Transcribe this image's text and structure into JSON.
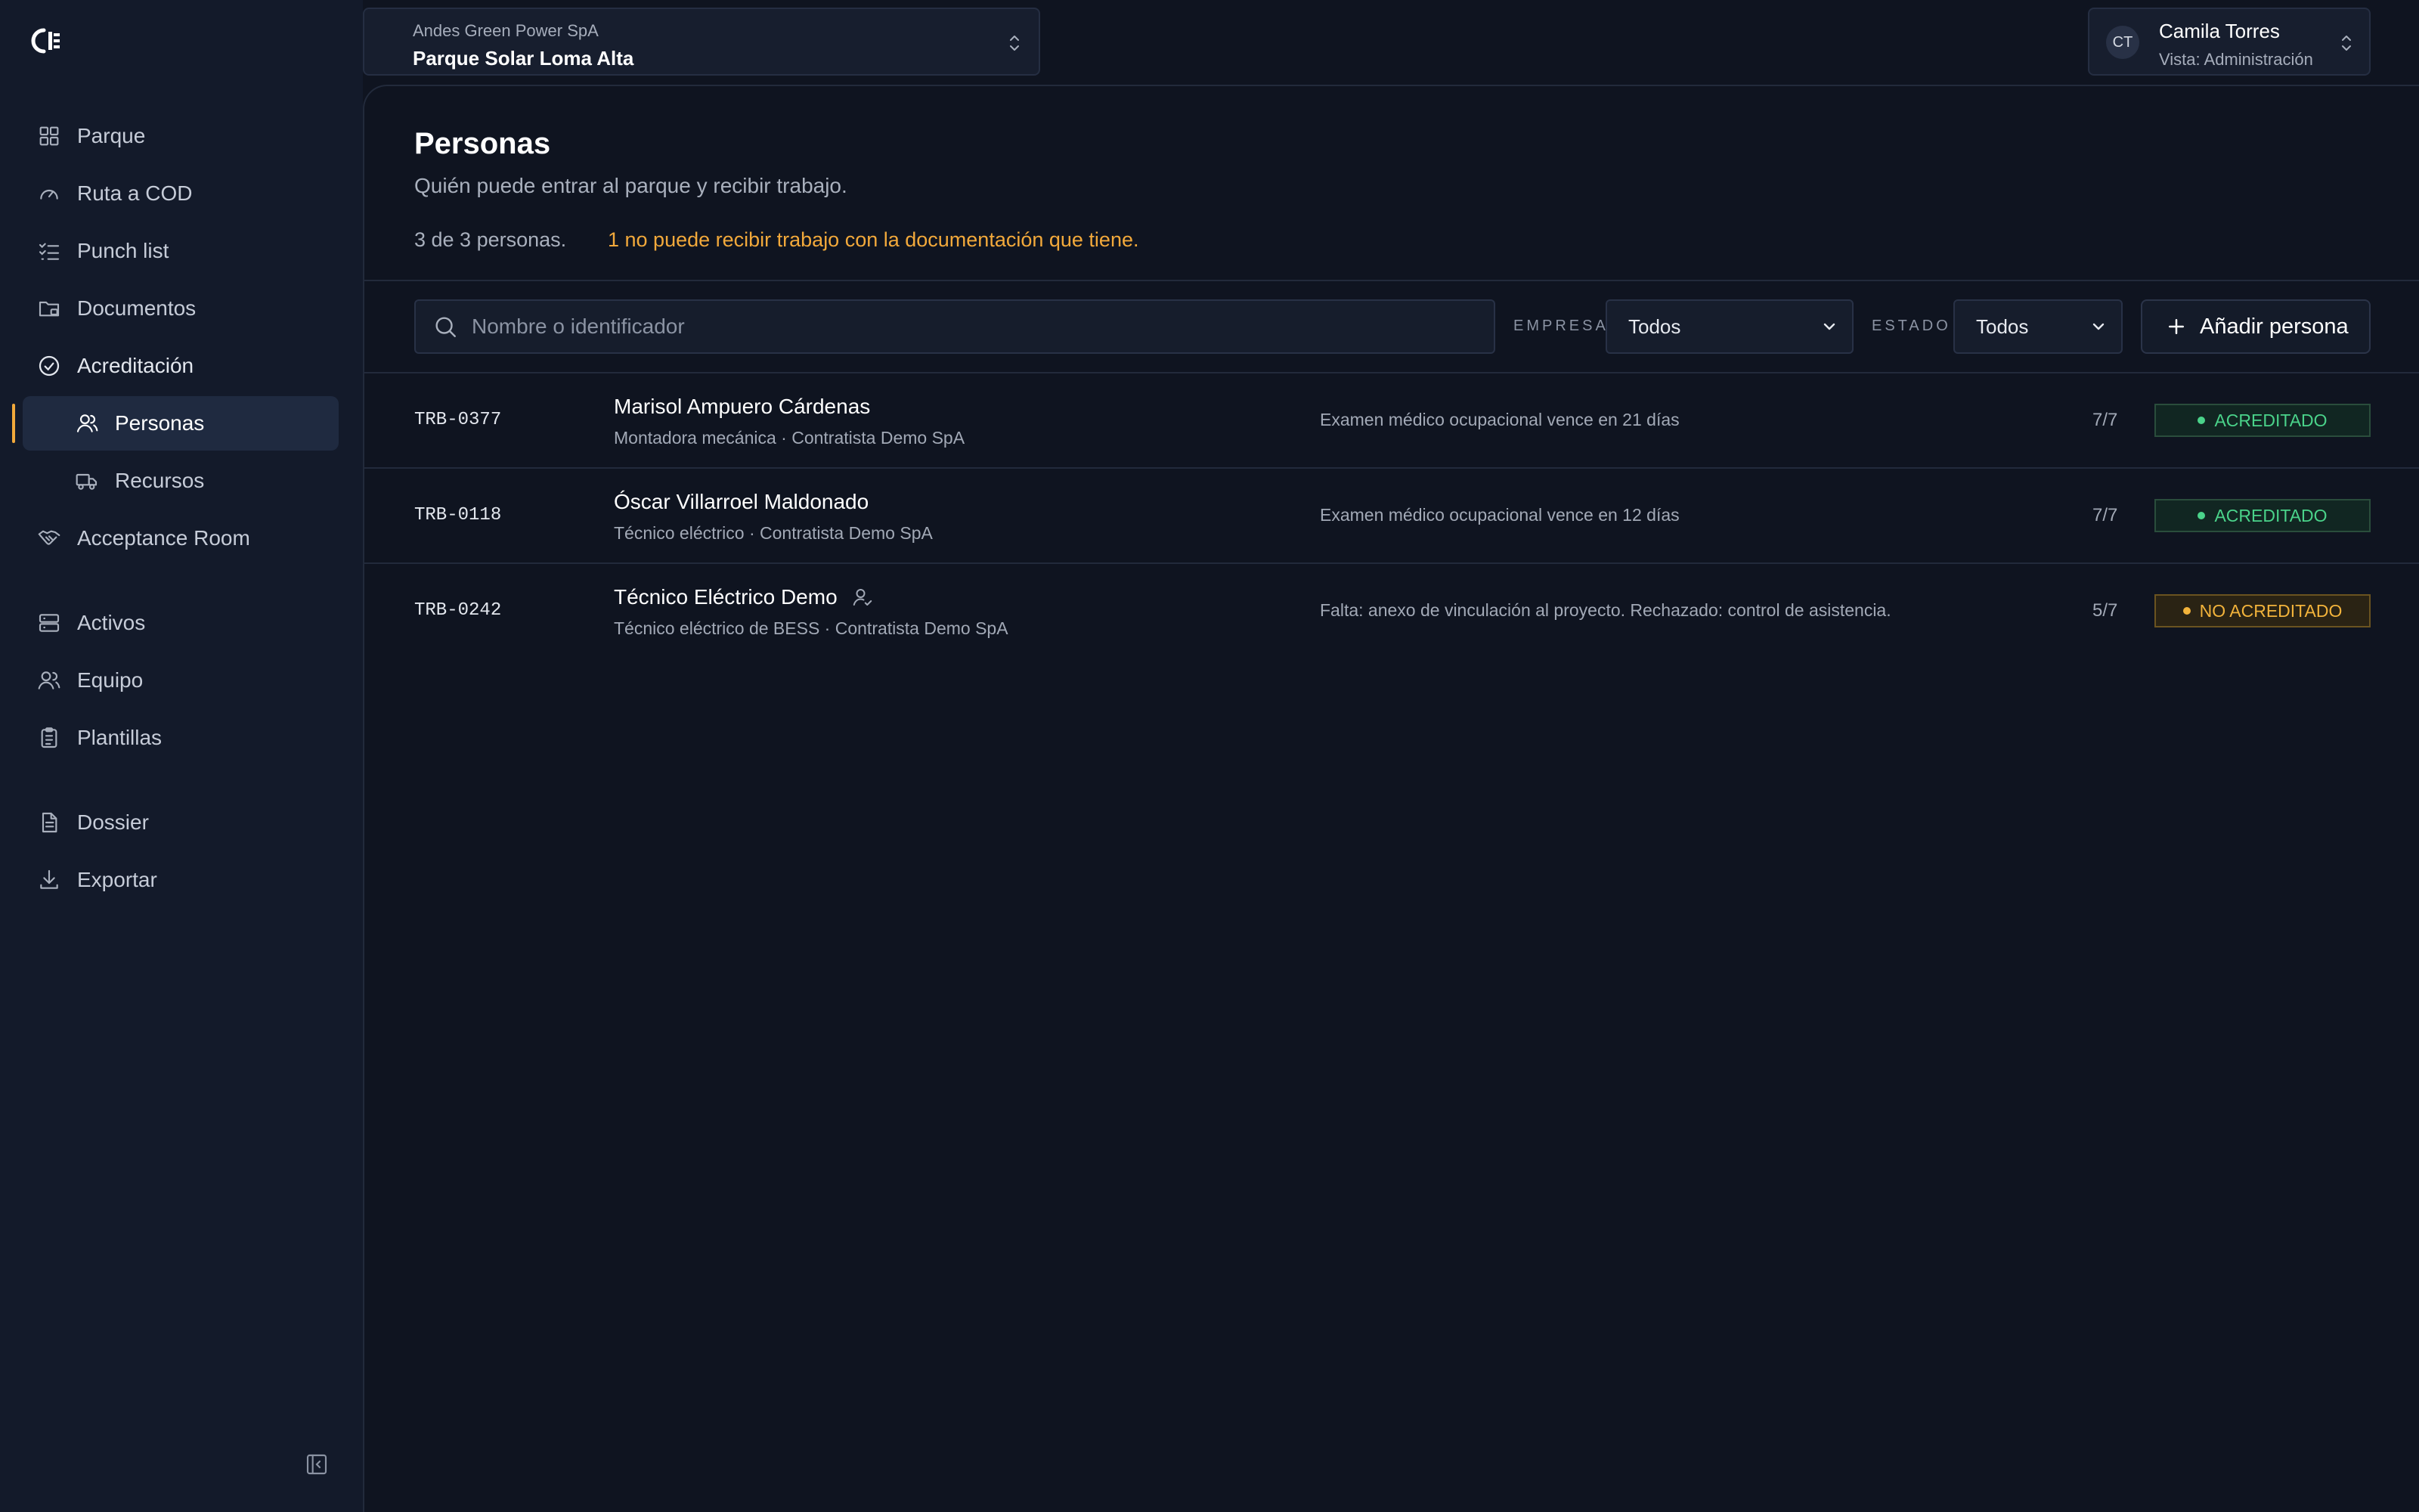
{
  "header": {
    "org_name": "Andes Green Power SpA",
    "project_name": "Parque Solar Loma Alta",
    "user_initials": "CT",
    "user_name": "Camila Torres",
    "user_role": "Vista: Administración"
  },
  "sidebar": {
    "items": [
      {
        "label": "Parque",
        "icon": "grid-icon"
      },
      {
        "label": "Ruta a COD",
        "icon": "gauge-icon"
      },
      {
        "label": "Punch list",
        "icon": "checklist-icon"
      },
      {
        "label": "Documentos",
        "icon": "folder-icon"
      },
      {
        "label": "Acreditación",
        "icon": "check-circle-icon"
      },
      {
        "label": "Personas",
        "icon": "users-icon"
      },
      {
        "label": "Recursos",
        "icon": "truck-icon"
      },
      {
        "label": "Acceptance Room",
        "icon": "handshake-icon"
      },
      {
        "label": "Activos",
        "icon": "server-icon"
      },
      {
        "label": "Equipo",
        "icon": "team-icon"
      },
      {
        "label": "Plantillas",
        "icon": "clipboard-icon"
      },
      {
        "label": "Dossier",
        "icon": "file-icon"
      },
      {
        "label": "Exportar",
        "icon": "download-icon"
      }
    ],
    "active": "Personas"
  },
  "page": {
    "title": "Personas",
    "subtitle": "Quién puede entrar al parque y recibir trabajo.",
    "count_text": "3 de 3 personas.",
    "warning_text": "1 no puede recibir trabajo con la documentación que tiene."
  },
  "filters": {
    "search_placeholder": "Nombre o identificador",
    "empresa_label": "EMPRESA",
    "empresa_value": "Todos",
    "estado_label": "ESTADO",
    "estado_value": "Todos",
    "add_label": "Añadir persona"
  },
  "people": [
    {
      "code": "TRB-0377",
      "name": "Marisol Ampuero Cárdenas",
      "meta": "Montadora mecánica · Contratista Demo SpA",
      "note": "Examen médico ocupacional vence en 21 días",
      "docs": "7/7",
      "status": "ACREDITADO"
    },
    {
      "code": "TRB-0118",
      "name": "Óscar Villarroel Maldonado",
      "meta": "Técnico eléctrico · Contratista Demo SpA",
      "note": "Examen médico ocupacional vence en 12 días",
      "docs": "7/7",
      "status": "ACREDITADO"
    },
    {
      "code": "TRB-0242",
      "name": "Técnico Eléctrico Demo",
      "meta": "Técnico eléctrico de BESS · Contratista Demo SpA",
      "note": "Falta: anexo de vinculación al proyecto. Rechazado: control de asistencia.",
      "docs": "5/7",
      "status": "NO ACREDITADO"
    }
  ],
  "colors": {
    "accent": "#f2a93b",
    "ok": "#4ad38a",
    "warn": "#f2b33b",
    "background": "#0f1420",
    "sidebar": "#131a2a"
  }
}
